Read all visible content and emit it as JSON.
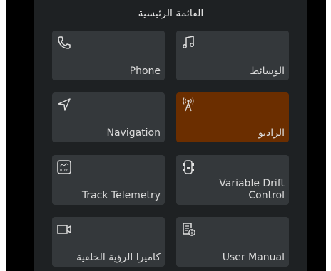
{
  "header": {
    "title": "القائمة الرئيسية"
  },
  "tiles": [
    {
      "label": "Phone",
      "icon": "phone-icon"
    },
    {
      "label": "الوسائط",
      "icon": "music-note-icon"
    },
    {
      "label": "Navigation",
      "icon": "navigation-arrow-icon"
    },
    {
      "label": "الراديو",
      "icon": "radio-tower-icon",
      "active": true
    },
    {
      "label": "Track Telemetry",
      "icon": "telemetry-gauge-icon"
    },
    {
      "label": "Variable Drift Control",
      "icon": "car-drift-icon"
    },
    {
      "label": "كاميرا الرؤية الخلفية",
      "icon": "video-camera-icon"
    },
    {
      "label": "User Manual",
      "icon": "manual-info-icon"
    }
  ],
  "colors": {
    "active_tile": "#6b2e00",
    "tile": "#34383b",
    "panel": "#1e2123"
  }
}
